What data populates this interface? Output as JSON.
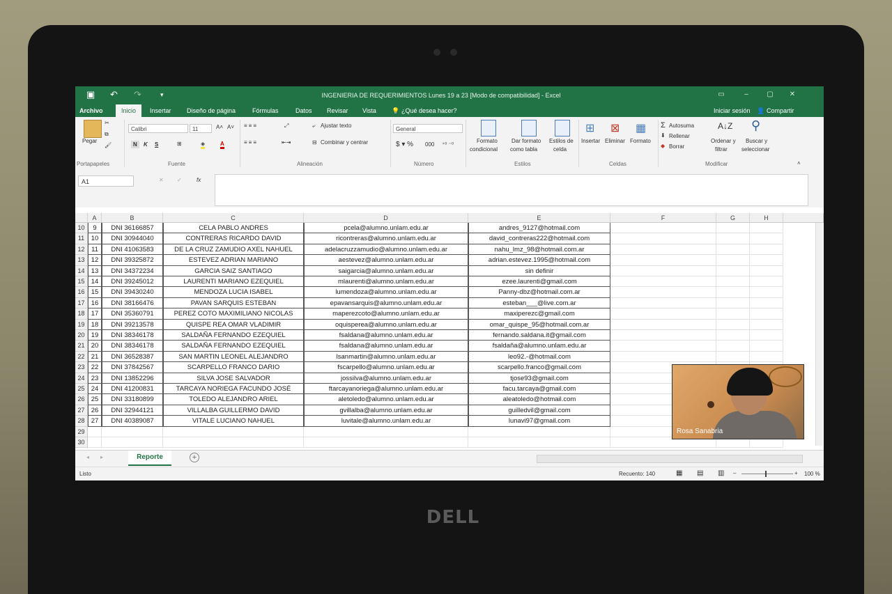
{
  "excel": {
    "title": "INGENIERIA DE REQUERIMIENTOS Lunes 19 a 23  [Modo de compatibilidad] - Excel",
    "tabs": [
      "Archivo",
      "Inicio",
      "Insertar",
      "Diseño de página",
      "Fórmulas",
      "Datos",
      "Revisar",
      "Vista"
    ],
    "active_tab": "Inicio",
    "tell_me": "¿Qué desea hacer?",
    "signin": "Iniciar sesión",
    "share": "Compartir",
    "ribbon": {
      "paste": "Pegar",
      "clipboard": "Portapapeles",
      "font_name": "Calibri",
      "font_size": "11",
      "font_group": "Fuente",
      "bold": "N",
      "italic": "K",
      "underline": "S",
      "wrap_text": "Ajustar texto",
      "merge": "Combinar y centrar",
      "alignment": "Alineación",
      "number_format": "General",
      "number": "Número",
      "cond_format_1": "Formato",
      "cond_format_2": "condicional",
      "table_format_1": "Dar formato",
      "table_format_2": "como tabla",
      "cell_styles_1": "Estilos de",
      "cell_styles_2": "celda",
      "styles": "Estilos",
      "insert": "Insertar",
      "delete": "Eliminar",
      "format": "Formato",
      "cells": "Celdas",
      "autosum": "Autosuma",
      "fill": "Rellenar",
      "clear": "Borrar",
      "sort_1": "Ordenar y",
      "sort_2": "filtrar",
      "find_1": "Buscar y",
      "find_2": "seleccionar",
      "editing": "Modificar"
    },
    "namebox": "A1",
    "columns": [
      "A",
      "B",
      "C",
      "D",
      "E",
      "F",
      "G",
      "H"
    ],
    "rows": [
      {
        "r": "10",
        "a": "9",
        "b": "DNI 36166857",
        "c": "CELA PABLO ANDRES",
        "d": "pcela@alumno.unlam.edu.ar",
        "e": "andres_9127@hotmail.com"
      },
      {
        "r": "11",
        "a": "10",
        "b": "DNI 30944040",
        "c": "CONTRERAS RICARDO DAVID",
        "d": "ricontreras@alumno.unlam.edu.ar",
        "e": "david_contreras222@hotmail.com"
      },
      {
        "r": "12",
        "a": "11",
        "b": "DNI 41063583",
        "c": "DE LA CRUZ ZAMUDIO AXEL NAHUEL",
        "d": "adelacruzzamudio@alumno.unlam.edu.ar",
        "e": "nahu_lmz_98@hotmail.com.ar"
      },
      {
        "r": "13",
        "a": "12",
        "b": "DNI 39325872",
        "c": "ESTEVEZ ADRIAN MARIANO",
        "d": "aestevez@alumno.unlam.edu.ar",
        "e": "adrian.estevez.1995@hotmail.com"
      },
      {
        "r": "14",
        "a": "13",
        "b": "DNI 34372234",
        "c": "GARCIA SAIZ SANTIAGO",
        "d": "saigarcia@alumno.unlam.edu.ar",
        "e": "sin definir"
      },
      {
        "r": "15",
        "a": "14",
        "b": "DNI 39245012",
        "c": "LAURENTI MARIANO EZEQUIEL",
        "d": "mlaurenti@alumno.unlam.edu.ar",
        "e": "ezee.laurenti@gmail.com"
      },
      {
        "r": "16",
        "a": "15",
        "b": "DNI 39430240",
        "c": "MENDOZA LUCIA ISABEL",
        "d": "lumendoza@alumno.unlam.edu.ar",
        "e": "Panny-dbz@hotmail.com.ar"
      },
      {
        "r": "17",
        "a": "16",
        "b": "DNI 38166476",
        "c": "PAVAN SARQUIS ESTEBAN",
        "d": "epavansarquis@alumno.unlam.edu.ar",
        "e": "esteban___@live.com.ar"
      },
      {
        "r": "18",
        "a": "17",
        "b": "DNI 35360791",
        "c": "PEREZ COTO MAXIMILIANO NICOLAS",
        "d": "maperezcoto@alumno.unlam.edu.ar",
        "e": "maxiperezc@gmail.com"
      },
      {
        "r": "19",
        "a": "18",
        "b": "DNI 39213578",
        "c": "QUISPE REA OMAR VLADIMIR",
        "d": "oquisperea@alumno.unlam.edu.ar",
        "e": "omar_quispe_95@hotmail.com.ar"
      },
      {
        "r": "20",
        "a": "19",
        "b": "DNI 38346178",
        "c": "SALDAÑA FERNANDO EZEQUIEL",
        "d": "fsaldana@alumno.unlam.edu.ar",
        "e": "fernando.saldana.it@gmail.com"
      },
      {
        "r": "21",
        "a": "20",
        "b": "DNI 38346178",
        "c": "SALDAÑA FERNANDO EZEQUIEL",
        "d": "fsaldana@alumno.unlam.edu.ar",
        "e": "fsaldaña@alumno.unlam.edu.ar"
      },
      {
        "r": "22",
        "a": "21",
        "b": "DNI 36528387",
        "c": "SAN MARTIN LEONEL ALEJANDRO",
        "d": "lsanmartin@alumno.unlam.edu.ar",
        "e": "leo92.-@hotmail.com"
      },
      {
        "r": "23",
        "a": "22",
        "b": "DNI 37842567",
        "c": "SCARPELLO FRANCO DARIO",
        "d": "fscarpello@alumno.unlam.edu.ar",
        "e": "scarpello.franco@gmail.com"
      },
      {
        "r": "24",
        "a": "23",
        "b": "DNI 13852296",
        "c": "SILVA JOSE SALVADOR",
        "d": "jossilva@alumno.unlam.edu.ar",
        "e": "tjose93@gmail.com"
      },
      {
        "r": "25",
        "a": "24",
        "b": "DNI 41200831",
        "c": "TARCAYA NORIEGA FACUNDO JOSÉ",
        "d": "ftarcayanoriega@alumno.unlam.edu.ar",
        "e": "facu.tarcaya@gmail.com"
      },
      {
        "r": "26",
        "a": "25",
        "b": "DNI 33180899",
        "c": "TOLEDO ALEJANDRO ARIEL",
        "d": "aletoledo@alumno.unlam.edu.ar",
        "e": "aleatoledo@hotmail.com"
      },
      {
        "r": "27",
        "a": "26",
        "b": "DNI 32944121",
        "c": "VILLALBA GUILLERMO DAVID",
        "d": "gvillalba@alumno.unlam.edu.ar",
        "e": "guilledvil@gmail.com"
      },
      {
        "r": "28",
        "a": "27",
        "b": "DNI 40389087",
        "c": "VITALE LUCIANO NAHUEL",
        "d": "luvitale@alumno.unlam.edu.ar",
        "e": "lunavi97@gmail.com"
      },
      {
        "r": "29",
        "a": "",
        "b": "",
        "c": "",
        "d": "",
        "e": ""
      },
      {
        "r": "30",
        "a": "",
        "b": "",
        "c": "",
        "d": "",
        "e": ""
      }
    ],
    "sheet_tab": "Reporte",
    "status_ready": "Listo",
    "status_count": "Recuento: 140",
    "zoom": "100 %"
  },
  "video": {
    "name": "Rosa Sanabria"
  },
  "brand": "DELL",
  "colors": {
    "excel_green": "#217346",
    "ribbon_bg": "#f3f3f3",
    "bezel": "#141414"
  }
}
